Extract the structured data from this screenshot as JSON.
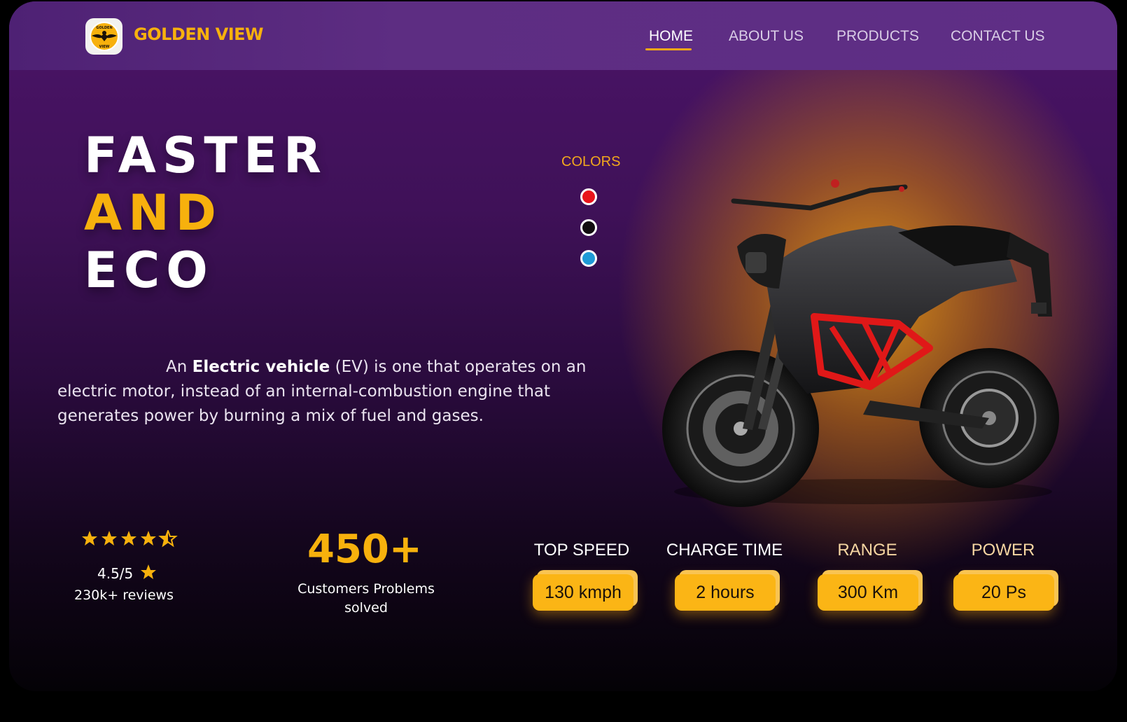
{
  "header": {
    "logo_text_lines": [
      "GOLDEN",
      "VIEW"
    ],
    "brand": "GOLDEN VIEW",
    "nav": [
      {
        "label": "HOME",
        "active": true
      },
      {
        "label": "ABOUT US",
        "active": false
      },
      {
        "label": "PRODUCTS",
        "active": false
      },
      {
        "label": "CONTACT US",
        "active": false
      }
    ]
  },
  "hero": {
    "headline": [
      "FASTER",
      "AND",
      "ECO"
    ],
    "headline_colors": [
      "#ffffff",
      "#f7b10d",
      "#ffffff"
    ],
    "description": {
      "prefix": "An ",
      "bold": "Electric vehicle",
      "suffix": " (EV) is one that operates on an electric motor, instead of an internal-combustion engine that generates power by burning a mix of fuel and gases."
    }
  },
  "colors": {
    "label": "COLORS",
    "options": [
      {
        "name": "red",
        "hex": "#e8141b"
      },
      {
        "name": "black",
        "hex": "#120d10"
      },
      {
        "name": "blue",
        "hex": "#1f9ad6"
      }
    ]
  },
  "rating": {
    "stars": 4.5,
    "score": "4.5/5",
    "reviews": "230k+ reviews"
  },
  "customers": {
    "count": "450+",
    "caption_lines": [
      "Customers Problems",
      "solved"
    ]
  },
  "specs": [
    {
      "label": "TOP SPEED",
      "value": "130 kmph"
    },
    {
      "label": "CHARGE TIME",
      "value": "2 hours"
    },
    {
      "label": "RANGE",
      "value": "300 Km"
    },
    {
      "label": "POWER",
      "value": "20 Ps"
    }
  ],
  "theme": {
    "accent": "#f7b10d",
    "background": "#3f1158",
    "navbar": "#5d2d82"
  },
  "icons": {
    "logo": "eagle-icon",
    "star": "star-icon",
    "half_star": "half-star-icon",
    "product": "motorcycle-image"
  }
}
